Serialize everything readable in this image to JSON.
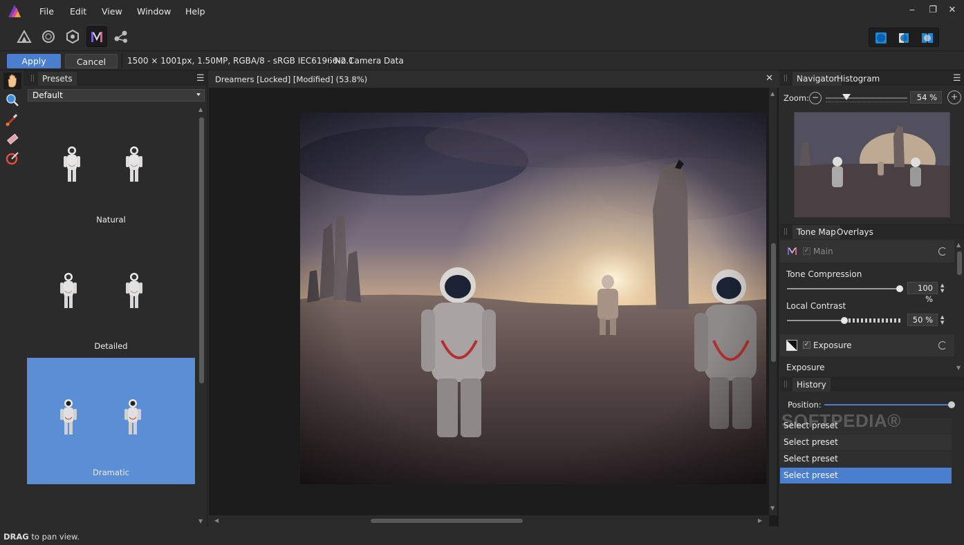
{
  "menu": {
    "items": [
      "File",
      "Edit",
      "View",
      "Window",
      "Help"
    ]
  },
  "toolbar": {
    "personas": [
      "photo-persona-icon",
      "liquify-persona-icon",
      "develop-persona-icon",
      "tone-mapping-persona-icon",
      "export-persona-icon"
    ],
    "active_persona": "tone-mapping-persona-icon"
  },
  "context": {
    "apply_label": "Apply",
    "cancel_label": "Cancel",
    "image_info": "1500 × 1001px, 1.50MP, RGBA/8 - sRGB IEC61966-2.1",
    "camera_info": "No Camera Data"
  },
  "presets_panel": {
    "tab": "Presets",
    "category": "Default",
    "presets": [
      {
        "label": "Natural",
        "selected": false
      },
      {
        "label": "Detailed",
        "selected": false
      },
      {
        "label": "Dramatic",
        "selected": true
      }
    ]
  },
  "document": {
    "title": "Dreamers [Locked] [Modified] (53.8%)"
  },
  "navigator": {
    "tabs": [
      "Navigator",
      "Histogram"
    ],
    "zoom_label": "Zoom:",
    "zoom_value": "54 %",
    "zoom_fraction": 0.25
  },
  "tonemap": {
    "tabs": [
      "Tone Map",
      "Overlays"
    ],
    "main_label": "Main",
    "tone_compression_label": "Tone Compression",
    "tone_compression_value": "100 %",
    "tone_compression_fraction": 1.0,
    "local_contrast_label": "Local Contrast",
    "local_contrast_value": "50 %",
    "local_contrast_fraction": 0.5,
    "exposure_group_label": "Exposure",
    "exposure_label": "Exposure"
  },
  "history": {
    "tab": "History",
    "position_label": "Position:",
    "position_fraction": 1.0,
    "items": [
      "Select preset",
      "Select preset",
      "Select preset",
      "Select preset"
    ],
    "selected_index": 3
  },
  "status": {
    "bold": "DRAG",
    "rest": " to pan view."
  },
  "watermark": "SOFTPEDIA®",
  "colors": {
    "accent": "#4a7fd0",
    "selected_preset": "#5b8ed5",
    "panel_bg": "#2b2b2b"
  }
}
